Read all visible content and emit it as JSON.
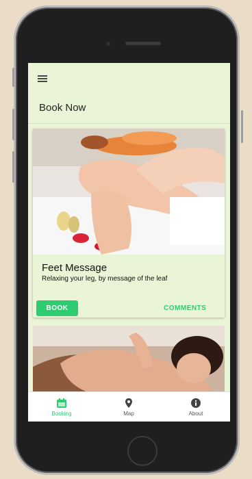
{
  "header": {
    "title": "Book Now"
  },
  "card": {
    "title": "Feet Message",
    "subtitle": "Relaxing your leg, by message of the leaf",
    "book_label": "BOOK",
    "comments_label": "COMMENTS"
  },
  "nav": {
    "items": [
      {
        "label": "Booking",
        "icon": "calendar-icon",
        "active": true
      },
      {
        "label": "Map",
        "icon": "map-pin-icon",
        "active": false
      },
      {
        "label": "About",
        "icon": "info-icon",
        "active": false
      }
    ]
  },
  "colors": {
    "accent": "#2ecc71",
    "background": "#eaf4d6"
  }
}
